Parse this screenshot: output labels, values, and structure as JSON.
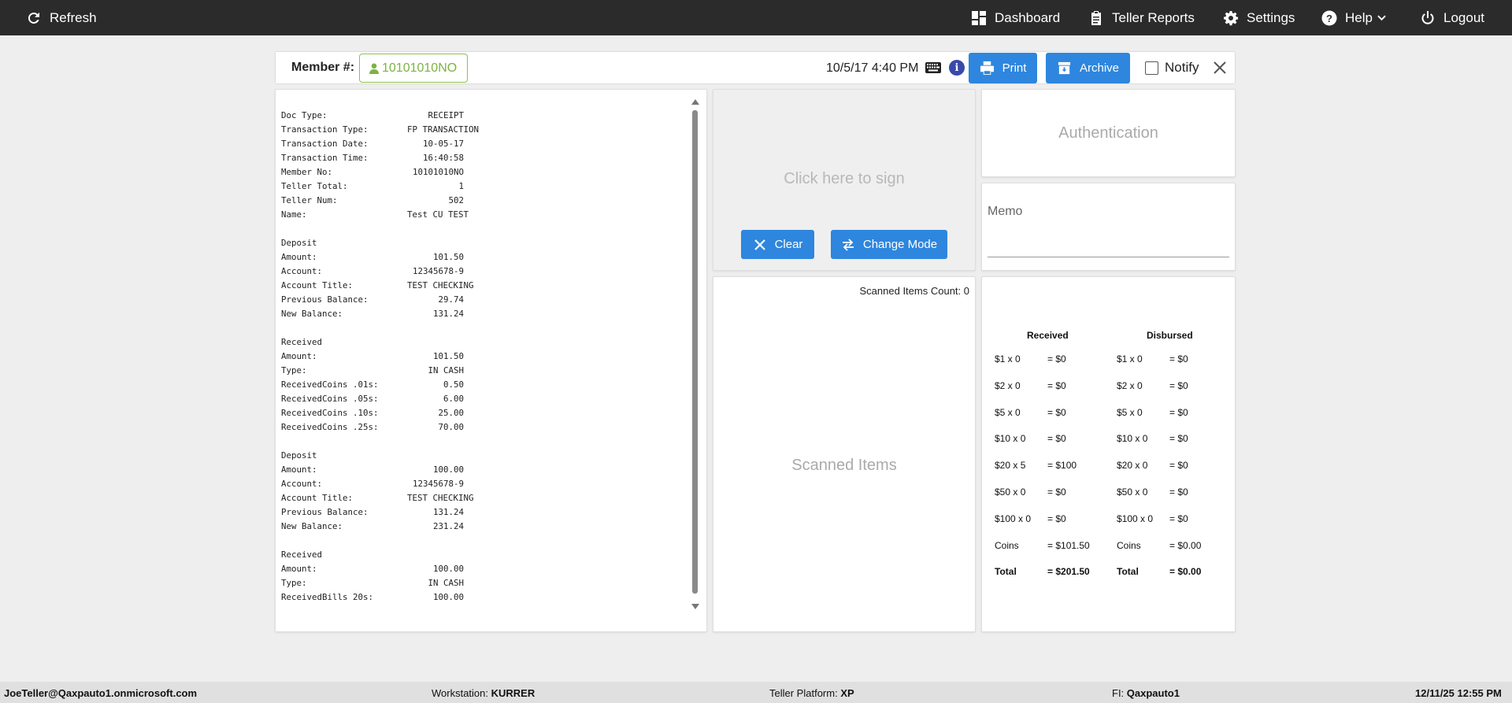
{
  "topbar": {
    "refresh": "Refresh",
    "dashboard": "Dashboard",
    "teller_reports": "Teller Reports",
    "settings": "Settings",
    "help": "Help",
    "logout": "Logout"
  },
  "memberbar": {
    "label": "Member #:",
    "member_number": "10101010NO",
    "datetime": "10/5/17 4:40 PM",
    "print": "Print",
    "archive": "Archive",
    "notify": "Notify"
  },
  "receipt": {
    "lines": [
      {
        "k": "Doc Type:",
        "v": "RECEIPT"
      },
      {
        "k": "Transaction Type:",
        "v": "FP TRANSACTION"
      },
      {
        "k": "Transaction Date:",
        "v": "10-05-17"
      },
      {
        "k": "Transaction Time:",
        "v": "16:40:58"
      },
      {
        "k": "Member No:",
        "v": "10101010NO"
      },
      {
        "k": "Teller Total:",
        "v": "1"
      },
      {
        "k": "Teller Num:",
        "v": "502"
      },
      {
        "k": "Name:",
        "v": "Test CU TEST"
      },
      {
        "k": "",
        "v": ""
      },
      {
        "k": "Deposit",
        "v": ""
      },
      {
        "k": "Amount:",
        "v": "101.50"
      },
      {
        "k": "Account:",
        "v": "12345678-9"
      },
      {
        "k": "Account Title:",
        "v": "TEST CHECKING"
      },
      {
        "k": "Previous Balance:",
        "v": "29.74"
      },
      {
        "k": "New Balance:",
        "v": "131.24"
      },
      {
        "k": "",
        "v": ""
      },
      {
        "k": "Received",
        "v": ""
      },
      {
        "k": "Amount:",
        "v": "101.50"
      },
      {
        "k": "Type:",
        "v": "IN CASH"
      },
      {
        "k": "ReceivedCoins .01s:",
        "v": "0.50"
      },
      {
        "k": "ReceivedCoins .05s:",
        "v": "6.00"
      },
      {
        "k": "ReceivedCoins .10s:",
        "v": "25.00"
      },
      {
        "k": "ReceivedCoins .25s:",
        "v": "70.00"
      },
      {
        "k": "",
        "v": ""
      },
      {
        "k": "Deposit",
        "v": ""
      },
      {
        "k": "Amount:",
        "v": "100.00"
      },
      {
        "k": "Account:",
        "v": "12345678-9"
      },
      {
        "k": "Account Title:",
        "v": "TEST CHECKING"
      },
      {
        "k": "Previous Balance:",
        "v": "131.24"
      },
      {
        "k": "New Balance:",
        "v": "231.24"
      },
      {
        "k": "",
        "v": ""
      },
      {
        "k": "Received",
        "v": ""
      },
      {
        "k": "Amount:",
        "v": "100.00"
      },
      {
        "k": "Type:",
        "v": "IN CASH"
      },
      {
        "k": "ReceivedBills 20s:",
        "v": "100.00"
      }
    ]
  },
  "signature": {
    "hint": "Click here to sign",
    "clear": "Clear",
    "change_mode": "Change Mode"
  },
  "scanned": {
    "count_label": "Scanned Items Count: 0",
    "placeholder": "Scanned Items"
  },
  "auth": {
    "label": "Authentication"
  },
  "memo": {
    "label": "Memo"
  },
  "cash": {
    "received_header": "Received",
    "disbursed_header": "Disbursed",
    "rows": [
      {
        "r_denom": "$1 x 0",
        "r_val": "= $0",
        "d_denom": "$1 x 0",
        "d_val": "= $0"
      },
      {
        "r_denom": "$2 x 0",
        "r_val": "= $0",
        "d_denom": "$2 x 0",
        "d_val": "= $0"
      },
      {
        "r_denom": "$5 x 0",
        "r_val": "= $0",
        "d_denom": "$5 x 0",
        "d_val": "= $0"
      },
      {
        "r_denom": "$10 x 0",
        "r_val": "= $0",
        "d_denom": "$10 x 0",
        "d_val": "= $0"
      },
      {
        "r_denom": "$20 x 5",
        "r_val": "= $100",
        "d_denom": "$20 x 0",
        "d_val": "= $0"
      },
      {
        "r_denom": "$50 x 0",
        "r_val": "= $0",
        "d_denom": "$50 x 0",
        "d_val": "= $0"
      },
      {
        "r_denom": "$100 x 0",
        "r_val": "= $0",
        "d_denom": "$100 x 0",
        "d_val": "= $0"
      },
      {
        "r_denom": "Coins",
        "r_val": "= $101.50",
        "d_denom": "Coins",
        "d_val": "= $0.00"
      }
    ],
    "total": {
      "r_label": "Total",
      "r_val": "= $201.50",
      "d_label": "Total",
      "d_val": "= $0.00"
    }
  },
  "status": {
    "user": "JoeTeller@Qaxpauto1.onmicrosoft.com",
    "workstation_label": "Workstation: ",
    "workstation": "KURRER",
    "platform_label": "Teller Platform: ",
    "platform": "XP",
    "fi_label": "FI: ",
    "fi": "Qaxpauto1",
    "datetime": "12/11/25 12:55 PM"
  }
}
